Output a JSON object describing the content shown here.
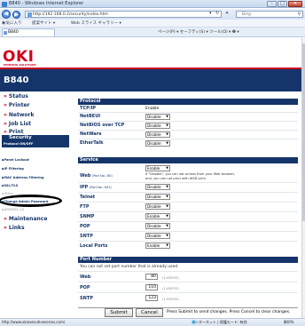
{
  "window": {
    "title": "B840 - Windows Internet Explorer",
    "min": "–",
    "max": "□",
    "close": "✕"
  },
  "address": {
    "url": "http://192.168.0.2/security/index.htm",
    "refresh": "↻",
    "stop": "✕",
    "dropdown": "▾",
    "search_placeholder": "Bing"
  },
  "favorites": {
    "fav_label": "お気に入り",
    "suggested": "提案サイト ▾",
    "gallery": "Web スライス ギャラリー ▾"
  },
  "tab": {
    "label": "B840",
    "commands": "ページ(P) ▾  セーフティ(S) ▾  ツール(O) ▾  ❷ ▾"
  },
  "brand": {
    "logo": "OKI",
    "tagline": "PRINTING SOLUTIONS",
    "model": "B840"
  },
  "sidebar": {
    "menus": [
      "Status",
      "Printer",
      "Network",
      "Job List",
      "Print"
    ],
    "security": "Security",
    "sub_items": [
      "Protocol ON/OFF",
      "Panel Lockout",
      "IP Filtering",
      "MAC Address Filtering",
      "SSL/TLS",
      "IPSec",
      "Change Admin Password",
      "IEEE802.1X"
    ],
    "bottom_menus": [
      "Maintenance",
      "Links"
    ]
  },
  "protocol": {
    "header": "Protocol",
    "rows": [
      {
        "label": "TCP/IP",
        "value": "Enable"
      },
      {
        "label": "NetBEUI",
        "value": "Disable"
      },
      {
        "label": "NetBIOS over TCP",
        "value": "Disable"
      },
      {
        "label": "NetWare",
        "value": "Disable"
      },
      {
        "label": "EtherTalk",
        "value": "Disable"
      }
    ]
  },
  "service": {
    "header": "Service",
    "web_label": "Web",
    "web_port": "(Port No.: 80)",
    "web_value": "Enable",
    "web_note1": "If \"Disable\", you can not access from your Web browser,",
    "web_note2": "and, you can not print with WSD print.",
    "ipp_label": "IPP",
    "ipp_port": "(Port No.: 631)",
    "ipp_value": "Disable",
    "rows": [
      {
        "label": "Telnet",
        "value": "Disable"
      },
      {
        "label": "FTP",
        "value": "Disable"
      },
      {
        "label": "SNMP",
        "value": "Enable"
      },
      {
        "label": "POP",
        "value": "Disable"
      },
      {
        "label": "SNTP",
        "value": "Disable"
      },
      {
        "label": "Local Ports",
        "value": "Enable"
      }
    ]
  },
  "port_number": {
    "header": "Port Number",
    "note": "You can not set port number that is already used.",
    "rows": [
      {
        "label": "Web",
        "value": "80",
        "range": "(1-65535)"
      },
      {
        "label": "POP",
        "value": "110",
        "range": "(1-65535)"
      },
      {
        "label": "SNTP",
        "value": "123",
        "range": "(1-65535)"
      }
    ]
  },
  "actions": {
    "submit": "Submit",
    "cancel": "Cancel",
    "hint": "Press Submit to send changes. Press Cancel to clear changes."
  },
  "statusbar": {
    "url": "http://www.okiexecutiveseries.com/",
    "zone": "インターネット | 保護モード: 有効",
    "zoom": "100%"
  }
}
